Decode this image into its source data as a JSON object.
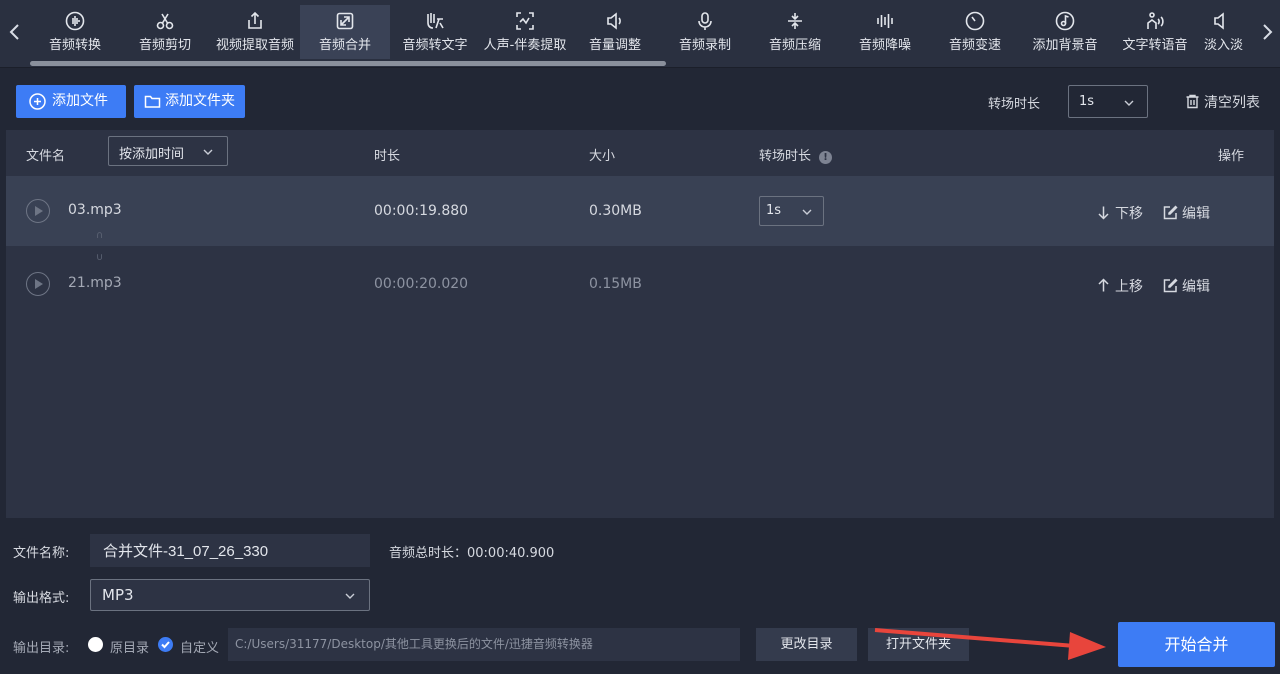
{
  "toolbar": {
    "tools": [
      {
        "label": "音频转换",
        "icon": "waveform-circle-icon"
      },
      {
        "label": "音频剪切",
        "icon": "scissors-icon"
      },
      {
        "label": "视频提取音频",
        "icon": "upload-box-icon"
      },
      {
        "label": "音频合并",
        "icon": "merge-arrows-icon",
        "active": true
      },
      {
        "label": "音频转文字",
        "icon": "hand-text-icon"
      },
      {
        "label": "人声-伴奏提取",
        "icon": "vocal-extract-icon"
      },
      {
        "label": "音量调整",
        "icon": "speaker-icon"
      },
      {
        "label": "音频录制",
        "icon": "microphone-icon"
      },
      {
        "label": "音频压缩",
        "icon": "compress-icon"
      },
      {
        "label": "音频降噪",
        "icon": "equalizer-bars-icon"
      },
      {
        "label": "音频变速",
        "icon": "speedometer-icon"
      },
      {
        "label": "添加背景音",
        "icon": "music-note-circle-icon"
      },
      {
        "label": "文字转语音",
        "icon": "text-speech-icon"
      },
      {
        "label": "淡入淡",
        "icon": "fade-icon"
      }
    ]
  },
  "actions": {
    "add_file": "添加文件",
    "add_folder": "添加文件夹",
    "transition_label": "转场时长",
    "transition_value": "1s",
    "clear_list": "清空列表"
  },
  "list": {
    "headers": {
      "filename": "文件名",
      "sort_value": "按添加时间",
      "duration": "时长",
      "size": "大小",
      "transition": "转场时长",
      "transition_info": "!",
      "operation": "操作"
    },
    "rows": [
      {
        "name": "03.mp3",
        "duration": "00:00:19.880",
        "size": "0.30MB",
        "transition": "1s",
        "move": "下移",
        "edit": "编辑"
      },
      {
        "name": "21.mp3",
        "duration": "00:00:20.020",
        "size": "0.15MB",
        "move": "上移",
        "edit": "编辑"
      }
    ]
  },
  "bottom": {
    "filename_label": "文件名称:",
    "filename_value": "合并文件-31_07_26_330",
    "total_duration": "音频总时长：00:00:40.900",
    "format_label": "输出格式:",
    "format_value": "MP3",
    "output_dir_label": "输出目录:",
    "radio_original": "原目录",
    "radio_custom": "自定义",
    "path": "C:/Users/31177/Desktop/其他工具更换后的文件/迅捷音频转换器",
    "change_dir": "更改目录",
    "open_folder": "打开文件夹",
    "start": "开始合并"
  },
  "colors": {
    "accent": "#3d7cf5",
    "background": "#222735",
    "panel": "#2d3344",
    "selected_row": "#394154",
    "annotation_arrow": "#e8453c"
  }
}
